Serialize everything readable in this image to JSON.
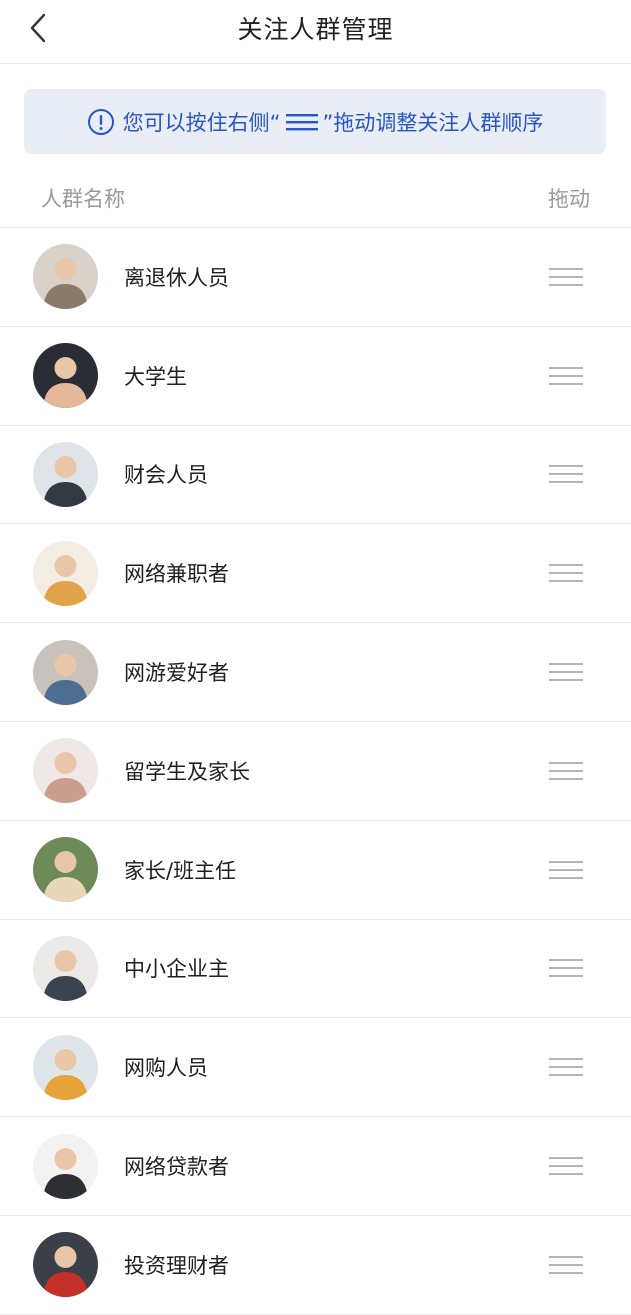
{
  "header": {
    "title": "关注人群管理"
  },
  "notice": {
    "prefix": "您可以按住右侧“",
    "suffix": "”拖动调整关注人群顺序",
    "color": "#2a55c4",
    "background": "#e8edf6"
  },
  "columns": {
    "name": "人群名称",
    "drag": "拖动"
  },
  "groups": [
    {
      "label": "离退休人员",
      "avatar_bg": "#d9d2c9",
      "avatar_fg": "#8a7a6a"
    },
    {
      "label": "大学生",
      "avatar_bg": "#2b2d36",
      "avatar_fg": "#e6b89a"
    },
    {
      "label": "财会人员",
      "avatar_bg": "#dfe4e8",
      "avatar_fg": "#333a44"
    },
    {
      "label": "网络兼职者",
      "avatar_bg": "#f4ede4",
      "avatar_fg": "#e3a34a"
    },
    {
      "label": "网游爱好者",
      "avatar_bg": "#c9c2bb",
      "avatar_fg": "#4e6d92"
    },
    {
      "label": "留学生及家长",
      "avatar_bg": "#efe8e6",
      "avatar_fg": "#c9a08e"
    },
    {
      "label": "家长/班主任",
      "avatar_bg": "#6d8a58",
      "avatar_fg": "#e8d7b8"
    },
    {
      "label": "中小企业主",
      "avatar_bg": "#eceae8",
      "avatar_fg": "#3b4250"
    },
    {
      "label": "网购人员",
      "avatar_bg": "#dfe6ea",
      "avatar_fg": "#e7a23a"
    },
    {
      "label": "网络贷款者",
      "avatar_bg": "#f2f2f2",
      "avatar_fg": "#2d2f33"
    },
    {
      "label": "投资理财者",
      "avatar_bg": "#3a3f48",
      "avatar_fg": "#c4312a"
    }
  ]
}
